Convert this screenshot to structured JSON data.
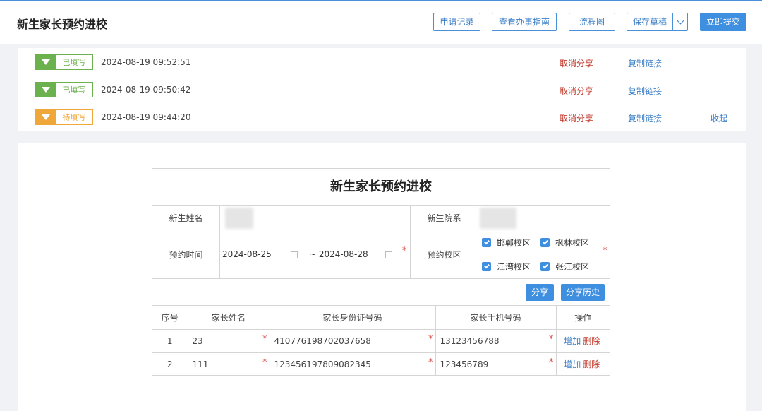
{
  "header": {
    "title": "新生家长预约进校",
    "buttons": {
      "records": "申请记录",
      "guide": "查看办事指南",
      "flow": "流程图",
      "save": "保存草稿",
      "submit": "立即提交"
    }
  },
  "records": [
    {
      "status": "已填写",
      "status_color": "#6bb24e",
      "time": "2024-08-19 09:52:51",
      "cancel": "取消分享",
      "copy": "复制链接"
    },
    {
      "status": "已填写",
      "status_color": "#6bb24e",
      "time": "2024-08-19 09:50:42",
      "cancel": "取消分享",
      "copy": "复制链接"
    },
    {
      "status": "待填写",
      "status_color": "#f0a73a",
      "time": "2024-08-19 09:44:20",
      "cancel": "取消分享",
      "copy": "复制链接",
      "collapse": "收起"
    }
  ],
  "form": {
    "title": "新生家长预约进校",
    "student_name_label": "新生姓名",
    "student_dept_label": "新生院系",
    "time_label": "预约时间",
    "date_start": "2024-08-25",
    "date_end": "~ 2024-08-28",
    "campus_label": "预约校区",
    "campuses": [
      "邯郸校区",
      "枫林校区",
      "江湾校区",
      "张江校区"
    ],
    "share": "分享",
    "share_history": "分享历史",
    "table": {
      "headers": [
        "序号",
        "家长姓名",
        "家长身份证号码",
        "家长手机号码",
        "操作"
      ],
      "rows": [
        {
          "no": "1",
          "name": "23",
          "id": "410776198702037658",
          "phone": "13123456788",
          "add": "增加",
          "del": "删除"
        },
        {
          "no": "2",
          "name": "111",
          "id": "123456197809082345",
          "phone": "123456789",
          "add": "增加",
          "del": "删除"
        }
      ]
    },
    "required_mark": "*"
  },
  "colors": {
    "accent": "#3e8fe0",
    "filled": "#6bb24e",
    "pending": "#f0a73a",
    "danger": "#c0392b"
  }
}
